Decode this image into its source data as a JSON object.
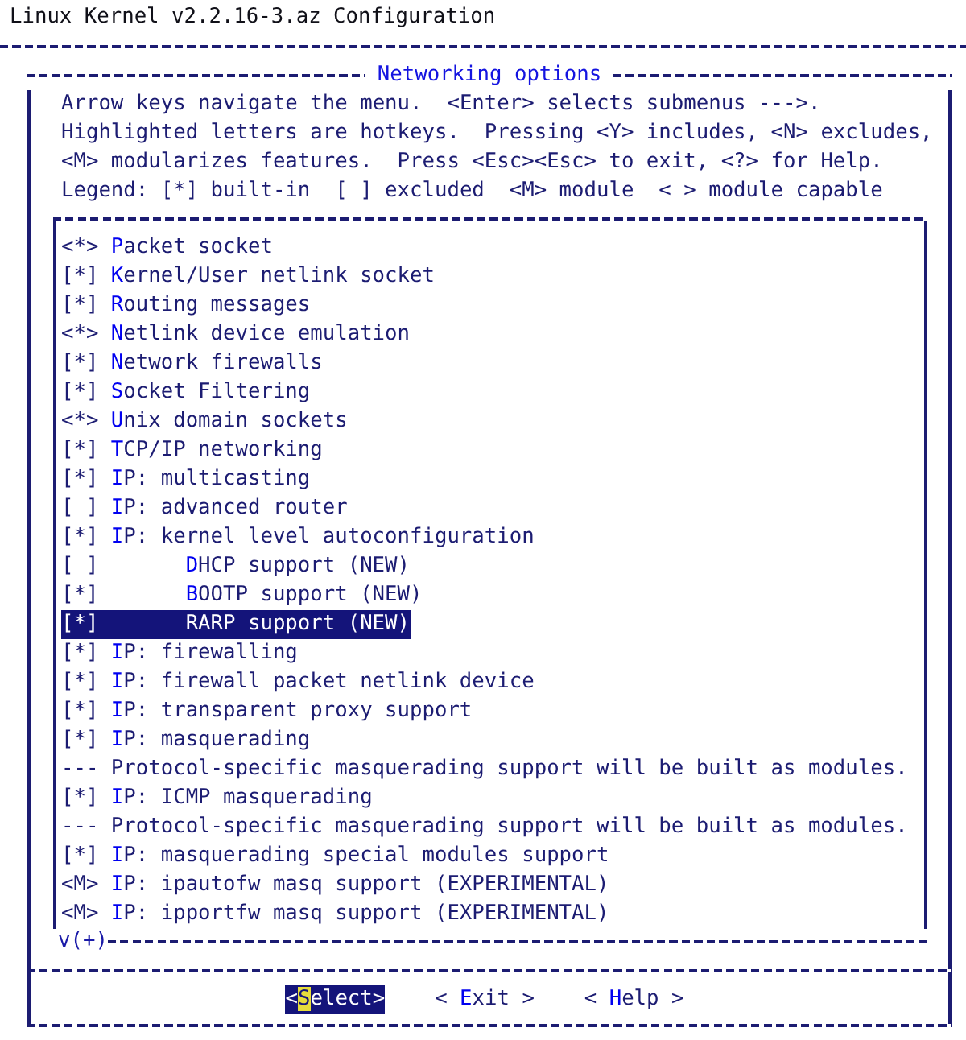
{
  "header": {
    "title": "Linux Kernel v2.2.16-3.az Configuration"
  },
  "dialog": {
    "title": "Networking options",
    "instructions": [
      "Arrow keys navigate the menu.  <Enter> selects submenus --->.",
      "Highlighted letters are hotkeys.  Pressing <Y> includes, <N> excludes,",
      "<M> modularizes features.  Press <Esc><Esc> to exit, <?> for Help.",
      "Legend: [*] built-in  [ ] excluded  <M> module  < > module capable"
    ],
    "menu": {
      "items": [
        {
          "kind": "option",
          "marker": "<*>",
          "label": "Packet socket",
          "selected": false
        },
        {
          "kind": "option",
          "marker": "[*]",
          "label": "Kernel/User netlink socket",
          "selected": false
        },
        {
          "kind": "option",
          "marker": "[*]",
          "label": "Routing messages",
          "selected": false
        },
        {
          "kind": "option",
          "marker": "<*>",
          "label": "Netlink device emulation",
          "selected": false
        },
        {
          "kind": "option",
          "marker": "[*]",
          "label": "Network firewalls",
          "selected": false
        },
        {
          "kind": "option",
          "marker": "[*]",
          "label": "Socket Filtering",
          "selected": false
        },
        {
          "kind": "option",
          "marker": "<*>",
          "label": "Unix domain sockets",
          "selected": false
        },
        {
          "kind": "option",
          "marker": "[*]",
          "label": "TCP/IP networking",
          "selected": false
        },
        {
          "kind": "option",
          "marker": "[*]",
          "label": "IP: multicasting",
          "selected": false
        },
        {
          "kind": "option",
          "marker": "[ ]",
          "label": "IP: advanced router",
          "selected": false
        },
        {
          "kind": "option",
          "marker": "[*]",
          "label": "IP: kernel level autoconfiguration",
          "selected": false,
          "children": [
            {
              "kind": "option",
              "marker": "[ ]",
              "label": "DHCP support (NEW)",
              "selected": false
            },
            {
              "kind": "option",
              "marker": "[*]",
              "label": "BOOTP support (NEW)",
              "selected": false
            },
            {
              "kind": "option",
              "marker": "[*]",
              "label": "RARP support (NEW)",
              "selected": true
            }
          ]
        },
        {
          "kind": "option",
          "marker": "[*]",
          "label": "IP: firewalling",
          "selected": false
        },
        {
          "kind": "option",
          "marker": "[*]",
          "label": "IP: firewall packet netlink device",
          "selected": false
        },
        {
          "kind": "option",
          "marker": "[*]",
          "label": "IP: transparent proxy support",
          "selected": false
        },
        {
          "kind": "option",
          "marker": "[*]",
          "label": "IP: masquerading",
          "selected": false
        },
        {
          "kind": "comment",
          "marker": "---",
          "label": "Protocol-specific masquerading support will be built as modules.",
          "selected": false
        },
        {
          "kind": "option",
          "marker": "[*]",
          "label": "IP: ICMP masquerading",
          "selected": false
        },
        {
          "kind": "comment",
          "marker": "---",
          "label": "Protocol-specific masquerading support will be built as modules.",
          "selected": false
        },
        {
          "kind": "option",
          "marker": "[*]",
          "label": "IP: masquerading special modules support",
          "selected": false
        },
        {
          "kind": "option",
          "marker": "<M>",
          "label": "IP: ipautofw masq support (EXPERIMENTAL)",
          "selected": false
        },
        {
          "kind": "option",
          "marker": "<M>",
          "label": "IP: ipportfw masq support (EXPERIMENTAL)",
          "selected": false
        }
      ],
      "scroll_indicator": "v(+)"
    },
    "buttons": [
      {
        "label": "<Select>",
        "selected": true
      },
      {
        "label": "< Exit >",
        "selected": false
      },
      {
        "label": "< Help >",
        "selected": false
      }
    ]
  }
}
